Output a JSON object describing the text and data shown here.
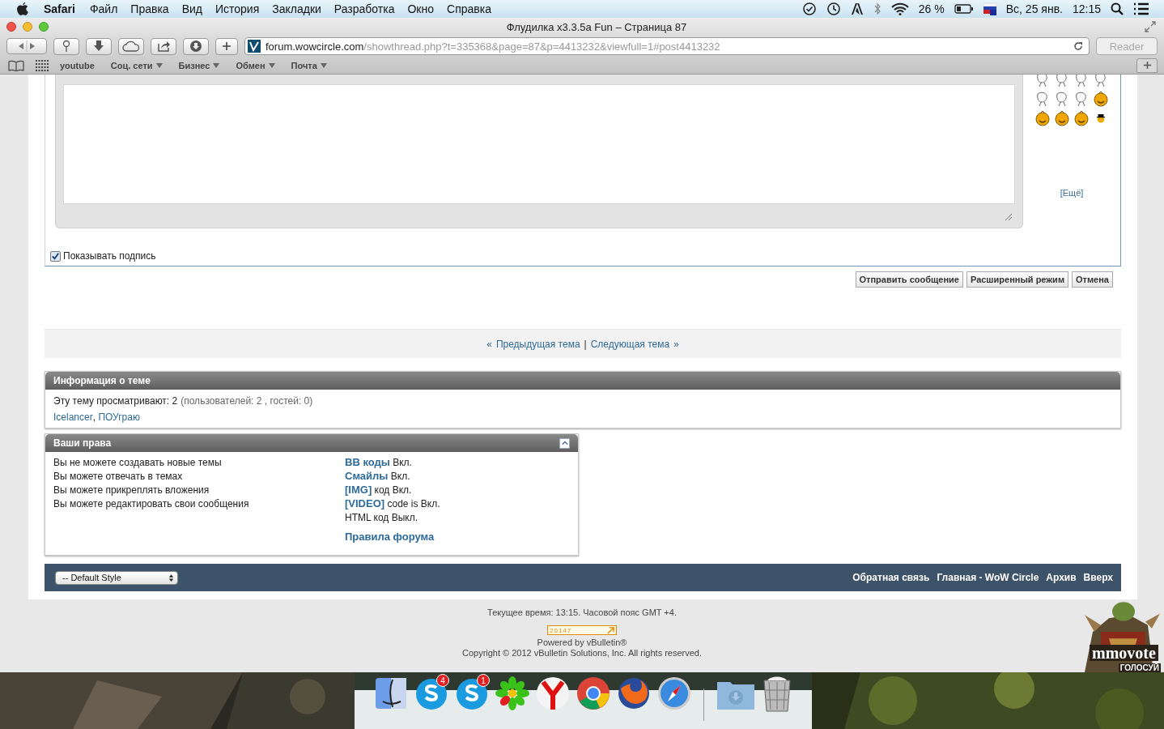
{
  "menubar": {
    "app": "Safari",
    "menus": [
      "Файл",
      "Правка",
      "Вид",
      "История",
      "Закладки",
      "Разработка",
      "Окно",
      "Справка"
    ],
    "battery": "26 %",
    "date": "Вс, 25 янв.",
    "time": "12:15"
  },
  "window": {
    "title": "Флудилка x3.3.5a Fun – Страница 87"
  },
  "address": {
    "domain": "forum.wowcircle.com",
    "path": "/showthread.php?t=335368&page=87&p=4413232&viewfull=1#post4413232",
    "reader": "Reader"
  },
  "bookmarks": [
    {
      "label": "youtube",
      "menu": false
    },
    {
      "label": "Соц. сети",
      "menu": true
    },
    {
      "label": "Бизнес",
      "menu": true
    },
    {
      "label": "Обмен",
      "menu": true
    },
    {
      "label": "Почта",
      "menu": true
    }
  ],
  "editor": {
    "more_link": "[Ещё]",
    "signature": {
      "label": "Показывать подпись",
      "checked": true
    }
  },
  "buttons": [
    "Отправить сообщение",
    "Расширенный режим",
    "Отмена"
  ],
  "thread_nav": {
    "prev_mark": "«",
    "prev": "Предыдущая тема",
    "separator": "|",
    "next": "Следующая тема",
    "next_mark": "»"
  },
  "thread_info": {
    "title": "Информация о теме",
    "viewing": "Эту тему просматривают: 2",
    "detail": "(пользователей: 2 , гостей: 0)",
    "users": [
      {
        "name": "Icelancer",
        "suffix": ","
      },
      {
        "name": "ПОУграю"
      }
    ]
  },
  "rights": {
    "title": "Ваши права",
    "left": [
      "Вы не можете создавать новые темы",
      "Вы можете отвечать в темах",
      "Вы можете прикреплять вложения",
      "Вы можете редактировать свои сообщения"
    ],
    "right": [
      {
        "label": "BB коды",
        "value": "Вкл."
      },
      {
        "label": "Смайлы",
        "value": "Вкл."
      },
      {
        "label": "[IMG]",
        "value": "код Вкл."
      },
      {
        "label": "[VIDEO]",
        "value": "code is Вкл."
      },
      {
        "value": "HTML код Выкл."
      }
    ],
    "rules_link": "Правила форума"
  },
  "footer": {
    "style_select": "-- Default Style",
    "links": [
      "Обратная связь",
      "Главная - WoW Circle",
      "Архив",
      "Вверх"
    ],
    "time_text": "Текущее время: 13:15. Часовой пояс GMT +4.",
    "counter": "20147",
    "powered": "Powered by vBulletin®",
    "copyright": "Copyright © 2012 vBulletin Solutions, Inc. All rights reserved."
  },
  "banner": {
    "kind": "picture",
    "title": "mmovote",
    "caption": "ГОЛОСУЙ"
  },
  "dock": [
    {
      "kind": "finder"
    },
    {
      "kind": "skype",
      "badge": "4"
    },
    {
      "kind": "skype",
      "badge": "1"
    },
    {
      "kind": "icq"
    },
    {
      "kind": "yandex"
    },
    {
      "kind": "chrome"
    },
    {
      "kind": "firefox"
    },
    {
      "kind": "safari"
    },
    {
      "kind": "separator"
    },
    {
      "kind": "downloads"
    },
    {
      "kind": "trash"
    }
  ]
}
